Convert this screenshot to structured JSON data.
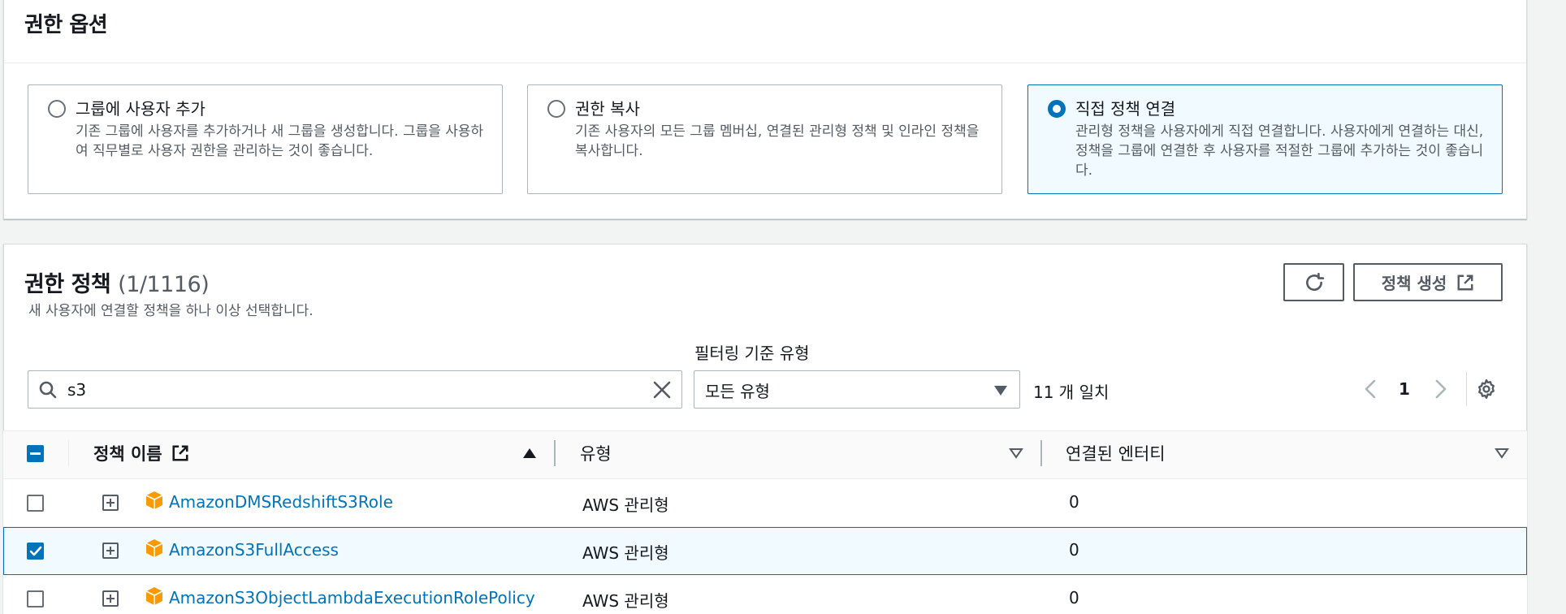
{
  "options_section": {
    "title": "권한 옵션",
    "tiles": [
      {
        "title": "그룹에 사용자 추가",
        "desc": "기존 그룹에 사용자를 추가하거나 새 그룹을 생성합니다. 그룹을 사용하여 직무별로 사용자 권한을 관리하는 것이 좋습니다.",
        "selected": false
      },
      {
        "title": "권한 복사",
        "desc": "기존 사용자의 모든 그룹 멤버십, 연결된 관리형 정책 및 인라인 정책을 복사합니다.",
        "selected": false
      },
      {
        "title": "직접 정책 연결",
        "desc": "관리형 정책을 사용자에게 직접 연결합니다. 사용자에게 연결하는 대신, 정책을 그룹에 연결한 후 사용자를 적절한 그룹에 추가하는 것이 좋습니다.",
        "selected": true
      }
    ]
  },
  "policies": {
    "title": "권한 정책",
    "count": "(1/1116)",
    "description": "새 사용자에 연결할 정책을 하나 이상 선택합니다.",
    "create_button": "정책 생성",
    "filter_label": "필터링 기준 유형",
    "search_value": "s3",
    "filter_type": "모든 유형",
    "match_count": "11 개 일치",
    "page": "1",
    "columns": {
      "name": "정책 이름",
      "type": "유형",
      "entities": "연결된 엔터티"
    },
    "rows": [
      {
        "name": "AmazonDMSRedshiftS3Role",
        "type": "AWS 관리형",
        "entities": "0",
        "checked": false
      },
      {
        "name": "AmazonS3FullAccess",
        "type": "AWS 관리형",
        "entities": "0",
        "checked": true
      },
      {
        "name": "AmazonS3ObjectLambdaExecutionRolePolicy",
        "type": "AWS 관리형",
        "entities": "0",
        "checked": false
      }
    ]
  },
  "colors": {
    "accent": "#0073bb",
    "selected_bg": "#f1faff",
    "aws_orange": "#ff9900"
  }
}
